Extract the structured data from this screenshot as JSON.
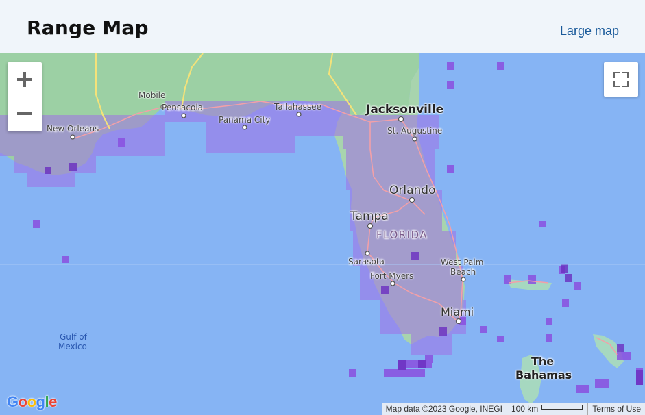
{
  "header": {
    "title": "Range Map",
    "large_map_link": "Large map"
  },
  "map": {
    "cities": {
      "jacksonville": "Jacksonville",
      "st_augustine": "St. Augustine",
      "tallahassee": "Tallahassee",
      "pensacola": "Pensacola",
      "mobile": "Mobile",
      "new_orleans": "New Orleans",
      "panama_city": "Panama City",
      "orlando": "Orlando",
      "tampa": "Tampa",
      "florida": "FLORIDA",
      "sarasota": "Sarasota",
      "west_palm_beach_1": "West Palm",
      "west_palm_beach_2": "Beach",
      "fort_myers": "Fort Myers",
      "miami": "Miami",
      "gulf_1": "Gulf of",
      "gulf_2": "Mexico",
      "bahamas_1": "The",
      "bahamas_2": "Bahamas"
    },
    "google_logo": "Google",
    "attribution": "Map data ©2023 Google, INEGI",
    "scale": "100 km",
    "terms": "Terms of Use",
    "colors": {
      "water": "#86b4f4",
      "land": "#9cd0a4",
      "range": "#a070e6",
      "road": "#f2a0a8",
      "highway": "#f4e27a"
    }
  }
}
